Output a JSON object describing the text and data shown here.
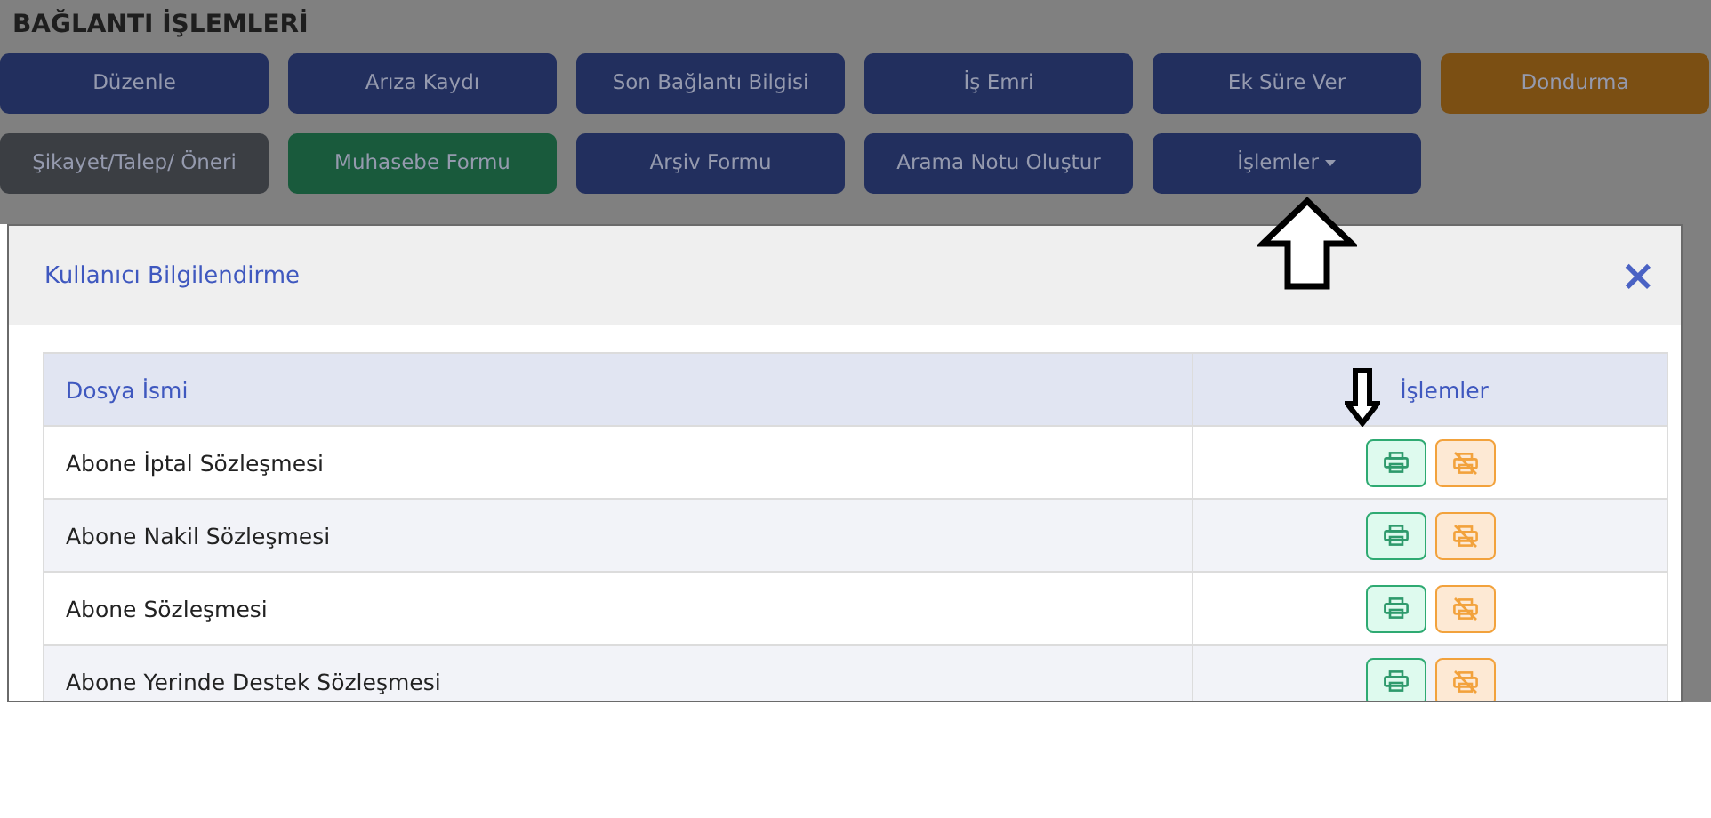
{
  "page_title": "BAĞLANTI İŞLEMLERİ",
  "buttons": [
    {
      "label": "Düzenle",
      "kind": "primary",
      "dropdown": false
    },
    {
      "label": "Arıza Kaydı",
      "kind": "primary",
      "dropdown": false
    },
    {
      "label": "Son Bağlantı Bilgisi",
      "kind": "primary",
      "dropdown": false
    },
    {
      "label": "İş Emri",
      "kind": "primary",
      "dropdown": false
    },
    {
      "label": "Ek Süre Ver",
      "kind": "primary",
      "dropdown": false
    },
    {
      "label": "Dondurma",
      "kind": "warning",
      "dropdown": false
    },
    {
      "label": "Şikayet/Talep/ Öneri",
      "kind": "secondary",
      "dropdown": false
    },
    {
      "label": "Muhasebe Formu",
      "kind": "success",
      "dropdown": false
    },
    {
      "label": "Arşiv Formu",
      "kind": "primary",
      "dropdown": false
    },
    {
      "label": "Arama Notu Oluştur",
      "kind": "primary",
      "dropdown": false
    },
    {
      "label": "İşlemler",
      "kind": "primary",
      "dropdown": true
    }
  ],
  "modal": {
    "title": "Kullanıcı Bilgilendirme",
    "close": "×",
    "table": {
      "columns": [
        "Dosya İsmi",
        "İşlemler"
      ],
      "rows": [
        {
          "name": "Abone İptal Sözleşmesi"
        },
        {
          "name": "Abone Nakil Sözleşmesi"
        },
        {
          "name": "Abone Sözleşmesi"
        },
        {
          "name": "Abone Yerinde Destek Sözleşmesi"
        }
      ]
    }
  }
}
